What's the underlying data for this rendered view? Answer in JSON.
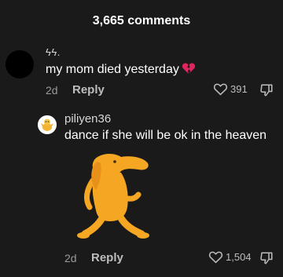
{
  "header": {
    "comment_count": "3,665 comments"
  },
  "comment": {
    "username": "ϟϟ.",
    "text": "my mom died yesterday",
    "emoji_icon": "broken-heart-icon",
    "time": "2d",
    "reply_label": "Reply",
    "likes": "391"
  },
  "reply": {
    "username": "piliyen36",
    "text": "dance if she will be ok in the heaven",
    "sticker_icon": "dancing-dog-sticker",
    "time": "2d",
    "reply_label": "Reply",
    "likes": "1,504"
  },
  "colors": {
    "background": "#1a1a1a",
    "text": "#ffffff",
    "muted": "#9a9a9a",
    "heart_broken": "#e0245e",
    "sticker_orange": "#f5a623"
  }
}
